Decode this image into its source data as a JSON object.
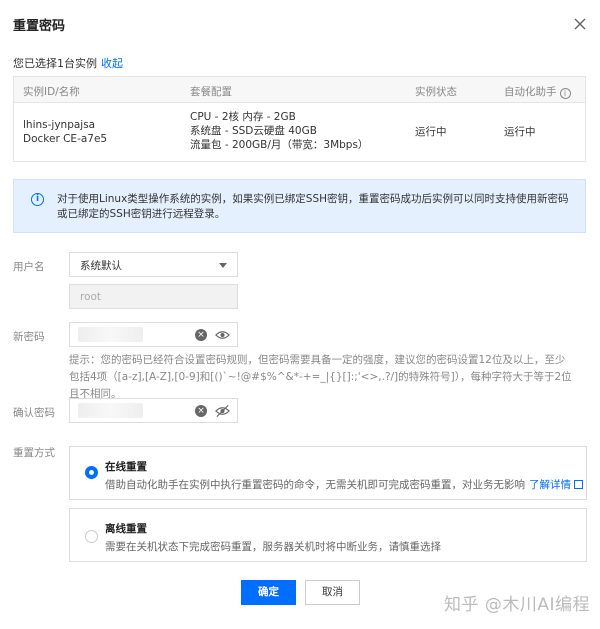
{
  "dialog": {
    "title": "重置密码",
    "selected_prefix": "您已选择1台实例",
    "collapse_link": "收起"
  },
  "table": {
    "headers": [
      "实例ID/名称",
      "套餐配置",
      "实例状态",
      "自动化助手"
    ],
    "info_icon": "info-circle-icon",
    "row": {
      "id": "lhins-jynpajsa",
      "name": "Docker CE-a7e5",
      "config": [
        "CPU - 2核 内存 - 2GB",
        "系统盘 - SSD云硬盘 40GB",
        "流量包 - 200GB/月（带宽：3Mbps）"
      ],
      "status": "运行中",
      "assistant": "运行中"
    }
  },
  "notice": {
    "text": "对于使用Linux类型操作系统的实例，如果实例已绑定SSH密钥，重置密码成功后实例可以同时支持使用新密码或已绑定的SSH密钥进行远程登录。"
  },
  "form": {
    "username_label": "用户名",
    "username_select": "系统默认",
    "username_value": "root",
    "new_password_label": "新密码",
    "hint": "提示：您的密码已经符合设置密码规则，但密码需要具备一定的强度，建议您的密码设置12位及以上，至少包括4项（[a-z],[A-Z],[0-9]和[()`~!@#$%^&*-+=_|{}[]:;'<>,.?/]的特殊符号]），每种字符大于等于2位且不相同。",
    "confirm_password_label": "确认密码",
    "reset_method_label": "重置方式"
  },
  "options": [
    {
      "title": "在线重置",
      "desc": "借助自动化助手在实例中执行重置密码的命令，无需关机即可完成密码重置，对业务无影响",
      "link": "了解详情",
      "selected": true
    },
    {
      "title": "离线重置",
      "desc": "需要在关机状态下完成密码重置，服务器关机时将中断业务，请慎重选择",
      "selected": false
    }
  ],
  "buttons": {
    "ok": "确定",
    "cancel": "取消"
  },
  "watermark": "知乎 @木川AI编程",
  "colors": {
    "accent": "#006eff",
    "success": "#0abf5b",
    "notice_bg": "#e5f0ff"
  }
}
